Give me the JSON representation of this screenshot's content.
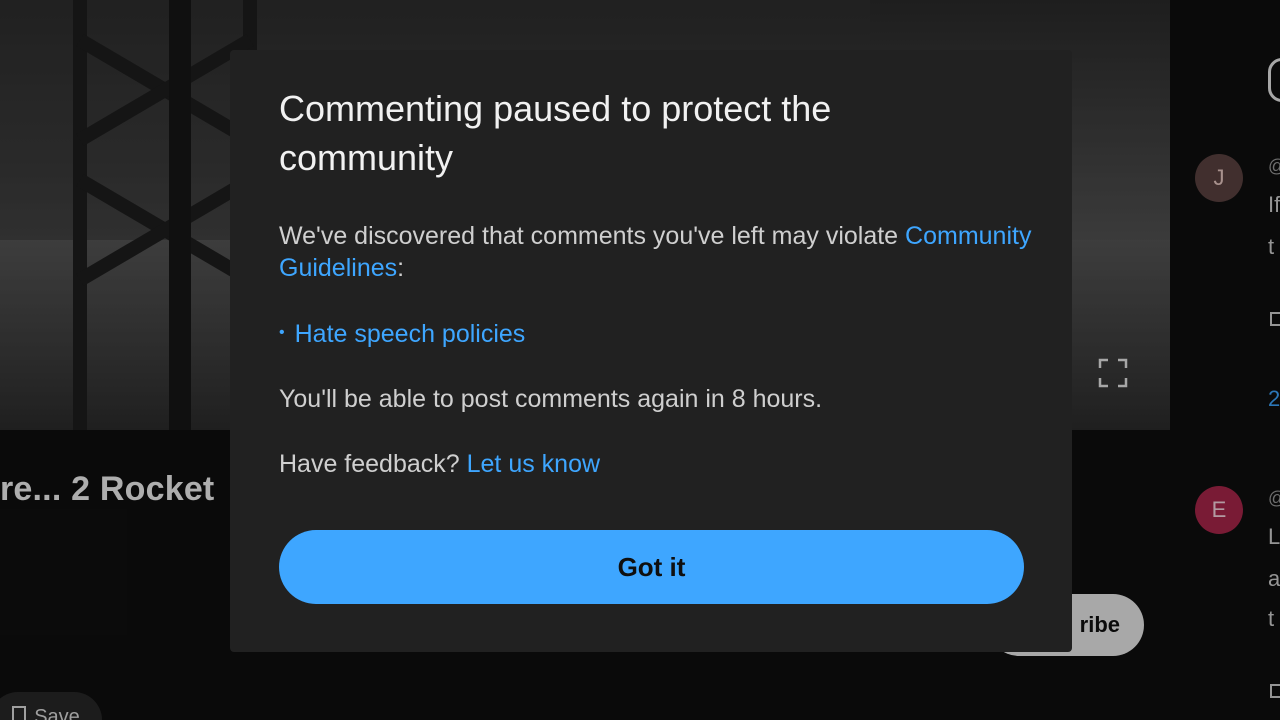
{
  "background": {
    "video_title": "re... 2 Rocket",
    "subscribe_label": "ribe",
    "save_label": "Save",
    "comments": [
      {
        "avatar_letter": "J",
        "avatar_color": "#5b4240",
        "text_fragments": [
          "@",
          "If",
          "t"
        ]
      },
      {
        "avatar_letter": "E",
        "avatar_color": "#a8264a",
        "text_fragments": [
          "@",
          "L",
          "a",
          "t"
        ]
      }
    ],
    "link_fragment": "2"
  },
  "dialog": {
    "title": "Commenting paused to protect the community",
    "message_prefix": "We've discovered that comments you've left may violate ",
    "guidelines_link": "Community Guidelines",
    "message_suffix": ":",
    "policies": [
      "Hate speech policies"
    ],
    "resume_text": "You'll be able to post comments again in 8 hours.",
    "feedback_prefix": "Have feedback? ",
    "feedback_link": "Let us know",
    "confirm_label": "Got it"
  },
  "colors": {
    "dialog_bg": "#212121",
    "accent": "#3ea6ff",
    "text_primary": "#f1f1f1",
    "text_secondary": "#cfcfcf"
  }
}
